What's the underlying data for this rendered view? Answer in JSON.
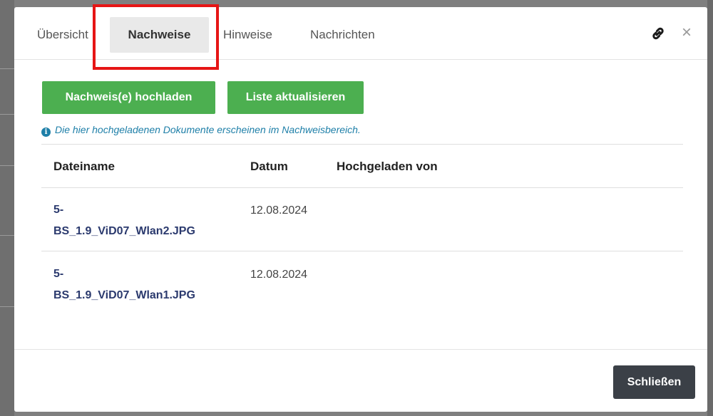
{
  "tabs": [
    {
      "label": "Übersicht"
    },
    {
      "label": "Nachweise"
    },
    {
      "label": "Hinweise"
    },
    {
      "label": "Nachrichten"
    }
  ],
  "header": {
    "link_icon": "link-icon",
    "close_glyph": "×"
  },
  "actions": {
    "upload_label": "Nachweis(e) hochladen",
    "refresh_label": "Liste aktualisieren"
  },
  "info": {
    "icon": "info-icon",
    "text": "Die hier hochgeladenen Dokumente erscheinen im Nachweisbereich."
  },
  "table": {
    "headers": [
      "Dateiname",
      "Datum",
      "Hochgeladen von"
    ],
    "rows": [
      {
        "file_line1": "5-",
        "file_line2": "BS_1.9_ViD07_Wlan2.JPG",
        "date": "12.08.2024",
        "uploaded_by": ""
      },
      {
        "file_line1": "5-",
        "file_line2": "BS_1.9_ViD07_Wlan1.JPG",
        "date": "12.08.2024",
        "uploaded_by": ""
      }
    ]
  },
  "footer": {
    "close_label": "Schließen"
  },
  "colors": {
    "accent_green": "#4caf50",
    "highlight_red": "#e61515",
    "link_blue": "#2b3a6e",
    "info_blue": "#1e7fa8",
    "dark_button": "#3b4047"
  }
}
